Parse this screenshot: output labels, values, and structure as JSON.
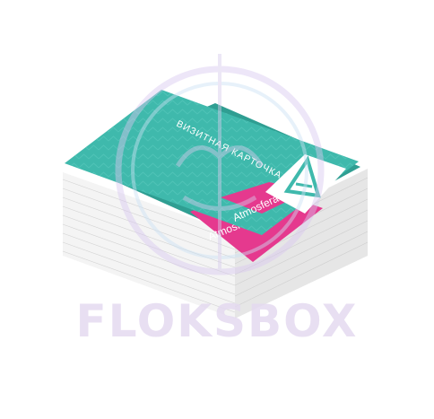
{
  "card": {
    "title": "ВИЗИТНАЯ КАРТОЧКА",
    "brand_front": "Atmosfera",
    "brand_back": "Atmosfera"
  },
  "watermark": {
    "text": "FLOKSBOX"
  },
  "colors": {
    "teal": "#3fb9ac",
    "teal_dark": "#2a9a8e",
    "magenta": "#e5398e",
    "paper_edge": "#ececec",
    "watermark_lilac": "#e4daf0"
  },
  "icons": {
    "logo": "triangle-a-logo-icon",
    "watermark_emblem": "circle-emblem-icon"
  }
}
